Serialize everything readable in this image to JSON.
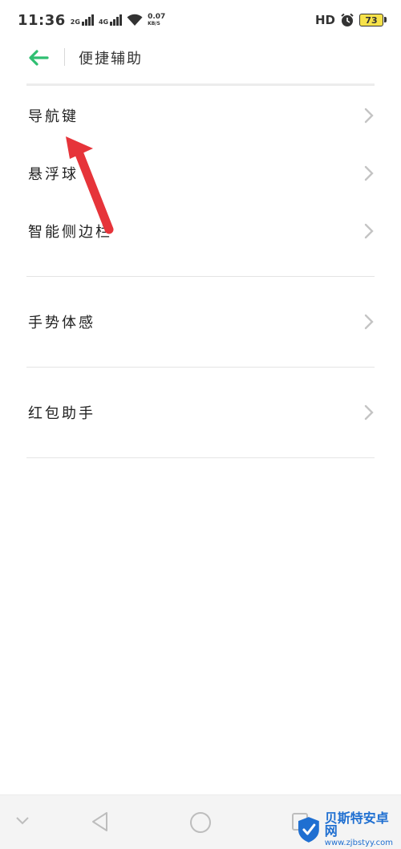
{
  "status_bar": {
    "time": "11:36",
    "network1": "2G",
    "network2": "4G",
    "speed_value": "0.07",
    "speed_unit": "KB/S",
    "hd": "HD",
    "battery": "73"
  },
  "header": {
    "title": "便捷辅助"
  },
  "list": {
    "items": [
      {
        "label": "导航键"
      },
      {
        "label": "悬浮球"
      },
      {
        "label": "智能侧边栏"
      },
      {
        "label": "手势体感"
      },
      {
        "label": "红包助手"
      }
    ]
  },
  "watermark": {
    "brand": "贝斯特安卓网",
    "url": "www.zjbstyy.com"
  },
  "colors": {
    "accent": "#2fbf71",
    "annotation": "#e6343a",
    "chevron": "#c4c4c4",
    "watermark": "#1f6fd1"
  }
}
